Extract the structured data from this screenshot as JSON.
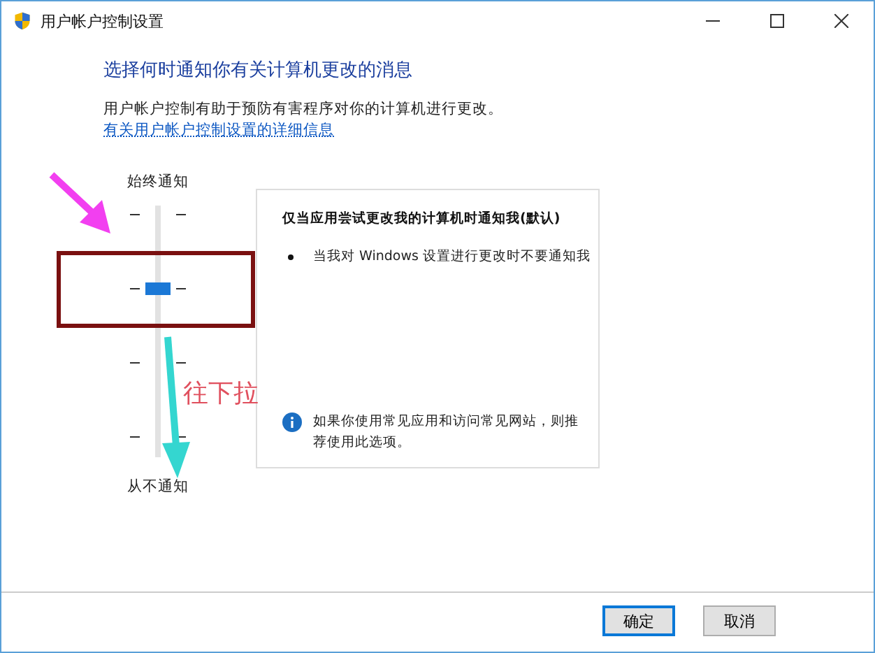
{
  "window": {
    "title": "用户帐户控制设置"
  },
  "heading": "选择何时通知你有关计算机更改的消息",
  "description": "用户帐户控制有助于预防有害程序对你的计算机进行更改。",
  "link": "有关用户帐户控制设置的详细信息",
  "slider": {
    "top_label": "始终通知",
    "bottom_label": "从不通知",
    "level": 0.667
  },
  "panel": {
    "title": "仅当应用尝试更改我的计算机时通知我(默认)",
    "bullets": [
      "当我对 Windows 设置进行更改时不要通知我"
    ],
    "note": "如果你使用常见应用和访问常见网站，则推荐使用此选项。"
  },
  "annotation": {
    "text": "往下拉"
  },
  "buttons": [
    {
      "label": "确定",
      "default": true
    },
    {
      "label": "取消",
      "default": false
    }
  ]
}
